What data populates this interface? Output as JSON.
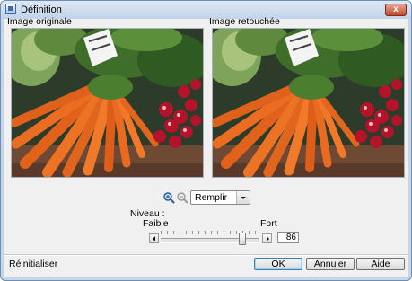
{
  "window": {
    "title": "Définition",
    "close_label": "x",
    "app_icon": "definition-app-icon",
    "close_icon": "close-x-icon"
  },
  "images": {
    "original_label": "Image originale",
    "retouched_label": "Image retouchée",
    "photo": "vegetables-photo"
  },
  "view": {
    "zoom_in_icon": "zoom-in-icon",
    "zoom_out_icon": "zoom-out-icon",
    "mode_selected": "Remplir"
  },
  "level": {
    "title": "Niveau :",
    "min_label": "Faible",
    "max_label": "Fort",
    "value": "86",
    "min": 0,
    "max": 100
  },
  "footer": {
    "reset_label": "Réinitialiser",
    "ok_label": "OK",
    "cancel_label": "Annuler",
    "help_label": "Aide"
  },
  "colors": {
    "titlebar": "#c2d4ea",
    "accent": "#3c7fb1",
    "close": "#c24a2c"
  }
}
